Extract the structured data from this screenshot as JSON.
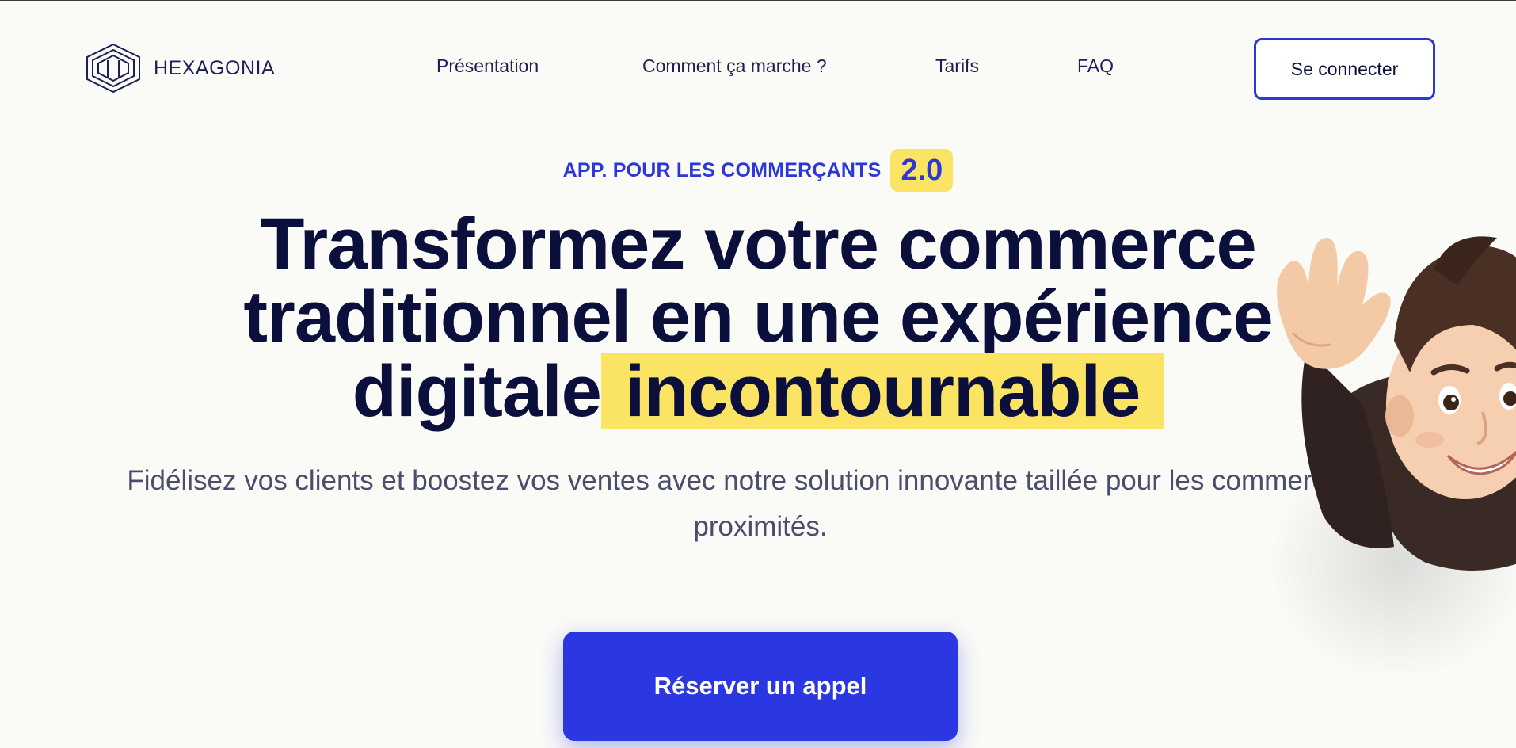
{
  "brand": {
    "name": "HEXAGONIA",
    "accent": "#2b37e0",
    "highlight": "#fbe463",
    "ink": "#0b0f3b"
  },
  "nav": {
    "items": [
      {
        "label": "Présentation"
      },
      {
        "label": "Comment ça marche ?"
      },
      {
        "label": "Tarifs"
      },
      {
        "label": "FAQ"
      }
    ],
    "login_label": "Se connecter"
  },
  "hero": {
    "eyebrow": "APP. POUR LES COMMERÇANTS",
    "version": "2.0",
    "headline_line1": "Transformez votre commerce",
    "headline_line2": "traditionnel en une expérience",
    "headline_line3_plain": "digitale",
    "headline_line3_highlight": "incontournable",
    "subtitle": "Fidélisez vos clients et boostez vos ventes avec notre solution innovante taillée pour les commerces de proximités.",
    "cta_label": "Réserver un appel"
  },
  "icons": {
    "logo": "hexagon-logo-icon",
    "mascot": "waving-memoji-icon"
  }
}
